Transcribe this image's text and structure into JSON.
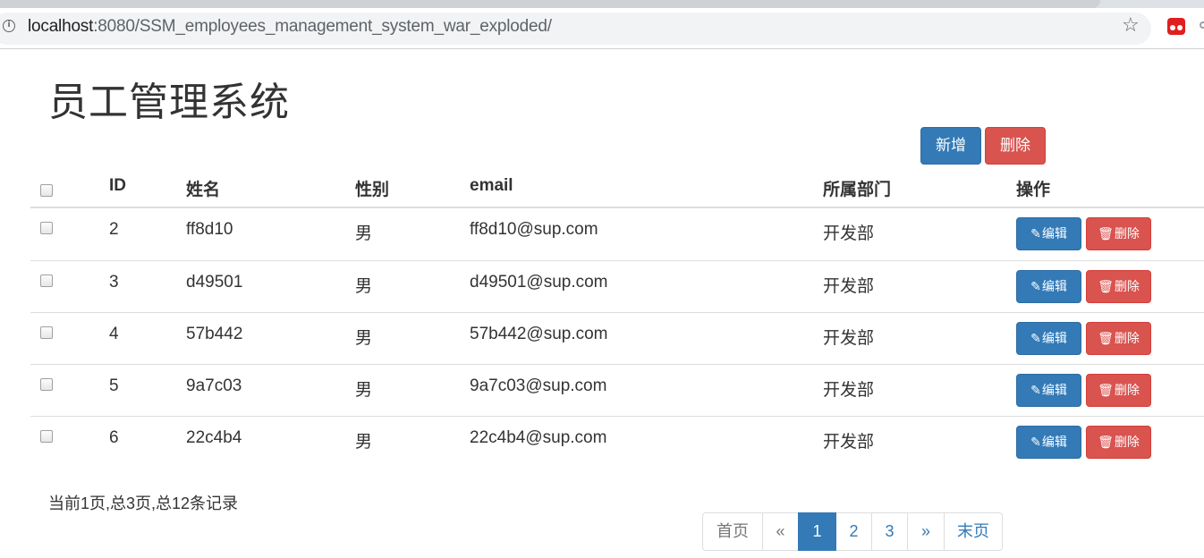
{
  "browser": {
    "url_host": "localhost",
    "url_rest": ":8080/SSM_employees_management_system_war_exploded/"
  },
  "page": {
    "title": "员工管理系统",
    "add_label": "新增",
    "delete_label": "删除"
  },
  "table": {
    "headers": [
      "ID",
      "姓名",
      "性别",
      "email",
      "所属部门",
      "操作"
    ],
    "rows": [
      {
        "id": "2",
        "name": "ff8d10",
        "gender": "男",
        "email": "ff8d10@sup.com",
        "dept": "开发部"
      },
      {
        "id": "3",
        "name": "d49501",
        "gender": "男",
        "email": "d49501@sup.com",
        "dept": "开发部"
      },
      {
        "id": "4",
        "name": "57b442",
        "gender": "男",
        "email": "57b442@sup.com",
        "dept": "开发部"
      },
      {
        "id": "5",
        "name": "9a7c03",
        "gender": "男",
        "email": "9a7c03@sup.com",
        "dept": "开发部"
      },
      {
        "id": "6",
        "name": "22c4b4",
        "gender": "男",
        "email": "22c4b4@sup.com",
        "dept": "开发部"
      }
    ],
    "edit_label": "编辑",
    "row_delete_label": "删除"
  },
  "pagination": {
    "info": "当前1页,总3页,总12条记录",
    "first": "首页",
    "prev": "«",
    "pages": [
      "1",
      "2",
      "3"
    ],
    "next": "»",
    "last": "末页"
  },
  "colors": {
    "primary": "#337ab7",
    "danger": "#d9534f"
  },
  "icons": {
    "edit": "pencil-icon",
    "delete": "trash-icon",
    "info": "info-icon",
    "bookmark": "star-icon"
  }
}
